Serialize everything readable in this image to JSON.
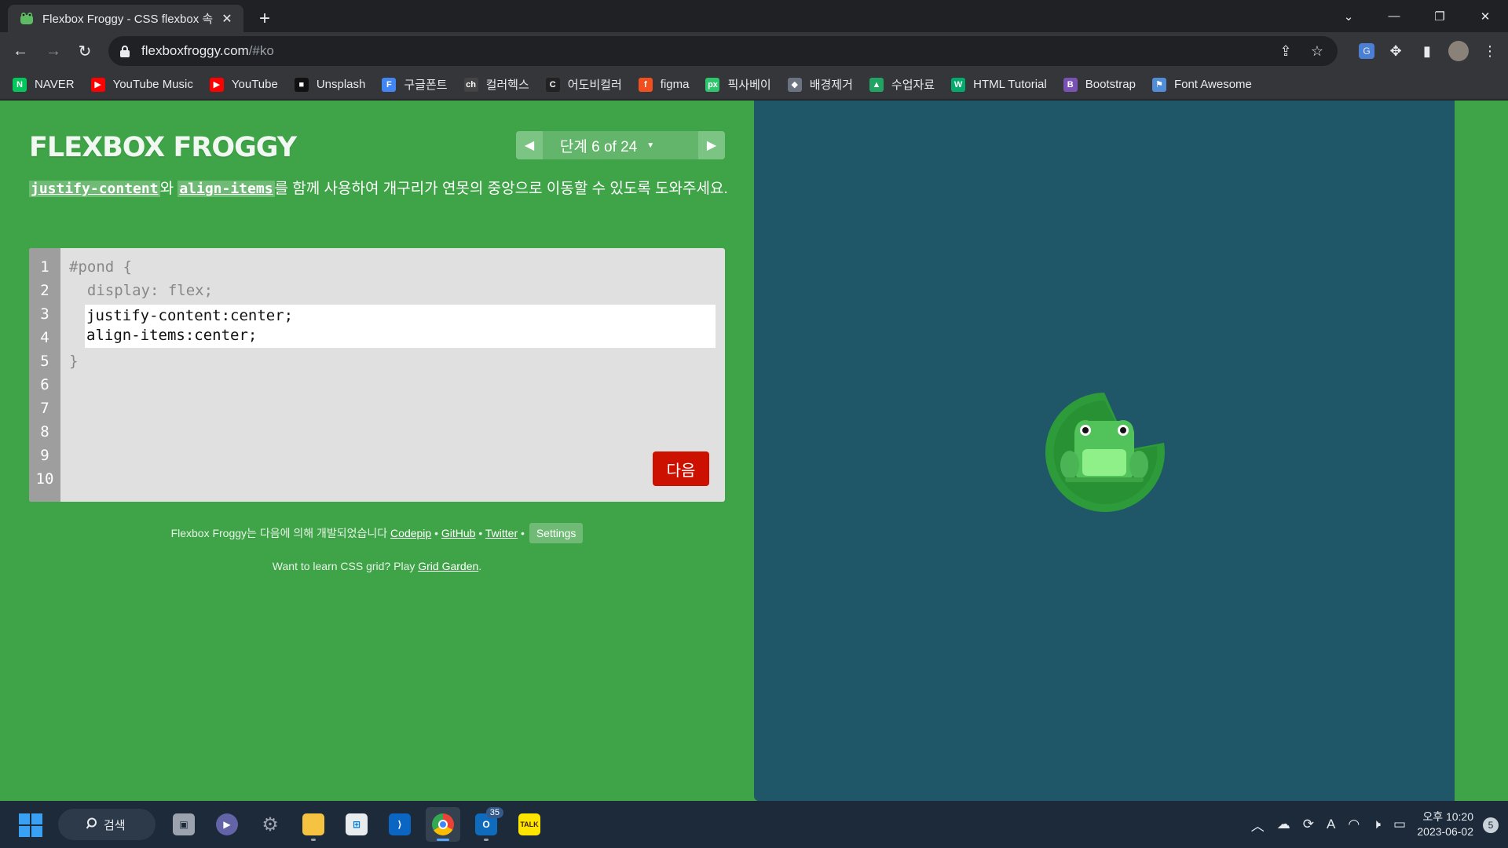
{
  "browser": {
    "tab_title": "Flexbox Froggy - CSS flexbox 속",
    "tab_close": "✕",
    "new_tab": "+",
    "url_host": "flexboxfroggy.com",
    "url_path": "/#ko"
  },
  "bookmarks": [
    {
      "label": "NAVER",
      "icon": "naver-icon",
      "color": "#03c75a",
      "glyph": "N"
    },
    {
      "label": "YouTube Music",
      "icon": "youtube-music-icon",
      "color": "#ff0000",
      "glyph": "▶"
    },
    {
      "label": "YouTube",
      "icon": "youtube-icon",
      "color": "#ff0000",
      "glyph": "▶"
    },
    {
      "label": "Unsplash",
      "icon": "unsplash-icon",
      "color": "#111111",
      "glyph": "■"
    },
    {
      "label": "구글폰트",
      "icon": "google-fonts-icon",
      "color": "#4285f4",
      "glyph": "F"
    },
    {
      "label": "컬러헥스",
      "icon": "colorhex-icon",
      "color": "#444444",
      "glyph": "ch"
    },
    {
      "label": "어도비컬러",
      "icon": "adobe-color-icon",
      "color": "#222222",
      "glyph": "C"
    },
    {
      "label": "figma",
      "icon": "figma-icon",
      "color": "#f24e1e",
      "glyph": "f"
    },
    {
      "label": "픽사베이",
      "icon": "pixabay-icon",
      "color": "#2ec66d",
      "glyph": "px"
    },
    {
      "label": "배경제거",
      "icon": "remove-bg-icon",
      "color": "#6b7280",
      "glyph": "◆"
    },
    {
      "label": "수업자료",
      "icon": "google-drive-icon",
      "color": "#1fa463",
      "glyph": "▲"
    },
    {
      "label": "HTML Tutorial",
      "icon": "w3schools-icon",
      "color": "#04aa6d",
      "glyph": "W"
    },
    {
      "label": "Bootstrap",
      "icon": "bootstrap-icon",
      "color": "#7952b3",
      "glyph": "B"
    },
    {
      "label": "Font Awesome",
      "icon": "font-awesome-icon",
      "color": "#528dd7",
      "glyph": "⚑"
    }
  ],
  "game": {
    "logo": "FLEXBOX FROGGY",
    "level_label": "단계 6 of 24",
    "prev_arrow": "◀",
    "next_arrow": "▶",
    "instr_code1": "justify-content",
    "instr_mid": "와 ",
    "instr_code2": "align-items",
    "instr_rest": "를 함께 사용하여 개구리가 연못의 중앙으로 이동할 수 있도록 도와주세요.",
    "line_numbers": [
      "1",
      "2",
      "3",
      "4",
      "5",
      "6",
      "7",
      "8",
      "9",
      "10"
    ],
    "code_before": [
      "#pond {",
      "  display: flex;"
    ],
    "code_input": [
      "justify-content:center;",
      "align-items:center;"
    ],
    "code_after": "}",
    "next_button": "다음",
    "credits_prefix": "Flexbox Froggy는 다음에 의해 개발되었습니다 ",
    "credits_links": [
      "Codepip",
      "GitHub",
      "Twitter"
    ],
    "settings_label": "Settings",
    "promo_prefix": "Want to learn CSS grid? Play ",
    "promo_link": "Grid Garden",
    "promo_suffix": "."
  },
  "colors": {
    "page_green": "#3fa347",
    "pond_blue": "#1f5768",
    "next_red": "#cc1100"
  },
  "taskbar": {
    "search_label": "검색",
    "mail_badge": "35",
    "time": "오후 10:20",
    "date": "2023-06-02",
    "notifications": "5",
    "ime": "A"
  }
}
